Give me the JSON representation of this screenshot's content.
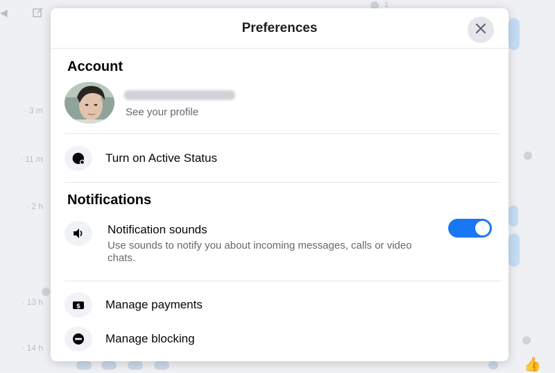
{
  "modal": {
    "title": "Preferences",
    "close_label": "Close"
  },
  "account": {
    "section_title": "Account",
    "see_profile": "See your profile",
    "active_status_label": "Turn on Active Status"
  },
  "notifications": {
    "section_title": "Notifications",
    "sounds_label": "Notification sounds",
    "sounds_description": "Use sounds to notify you about incoming messages, calls or video chats.",
    "sounds_enabled": true
  },
  "other": {
    "payments_label": "Manage payments",
    "blocking_label": "Manage blocking"
  },
  "background": {
    "timestamps": [
      "· 3 m",
      "· 11 m",
      "· 2 h",
      "· 13 h",
      "· 14 h"
    ],
    "top_count": "1"
  },
  "colors": {
    "accent": "#1877f2",
    "secondary_text": "#65676b",
    "divider": "#e4e6eb"
  }
}
